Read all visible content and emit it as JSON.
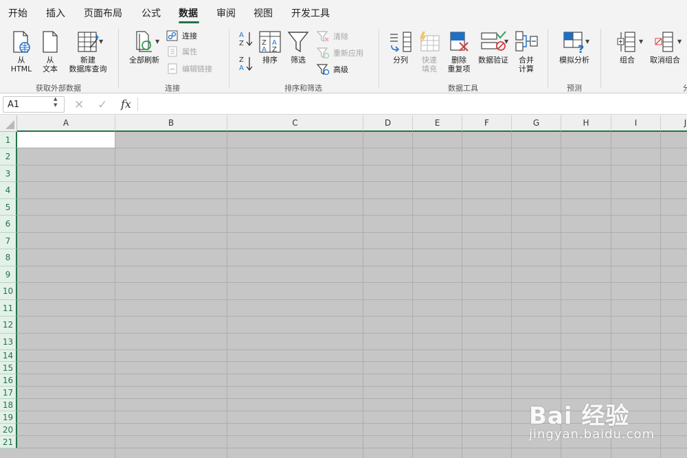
{
  "tabs": [
    {
      "label": "开始",
      "active": false
    },
    {
      "label": "插入",
      "active": false
    },
    {
      "label": "页面布局",
      "active": false
    },
    {
      "label": "公式",
      "active": false
    },
    {
      "label": "数据",
      "active": true
    },
    {
      "label": "审阅",
      "active": false
    },
    {
      "label": "视图",
      "active": false
    },
    {
      "label": "开发工具",
      "active": false
    }
  ],
  "ribbon": {
    "get_external": {
      "group_label": "获取外部数据",
      "from_html": "从\nHTML",
      "from_text": "从\n文本",
      "new_db_query": "新建\n数据库查询"
    },
    "connections": {
      "group_label": "连接",
      "refresh_all": "全部刷新",
      "connections": "连接",
      "properties": "属性",
      "edit_links": "编辑链接"
    },
    "sort_filter": {
      "group_label": "排序和筛选",
      "sort": "排序",
      "filter": "筛选",
      "clear": "清除",
      "reapply": "重新应用",
      "advanced": "高级"
    },
    "data_tools": {
      "group_label": "数据工具",
      "text_to_columns": "分列",
      "flash_fill": "快速\n填充",
      "remove_duplicates": "删除\n重复项",
      "data_validation": "数据验证",
      "consolidate": "合并\n计算"
    },
    "forecast": {
      "group_label": "预测",
      "what_if": "模拟分析"
    },
    "outline": {
      "group_label": "分",
      "group": "组合",
      "ungroup": "取消组合"
    }
  },
  "formula_bar": {
    "name_box": "A1",
    "fx": "fx",
    "formula": ""
  },
  "grid": {
    "columns": [
      "A",
      "B",
      "C",
      "D",
      "E",
      "F",
      "G",
      "H",
      "I",
      "J"
    ],
    "rows": [
      "1",
      "2",
      "3",
      "4",
      "5",
      "6",
      "7",
      "8",
      "9",
      "10",
      "11",
      "12",
      "13",
      "14",
      "15",
      "16",
      "17",
      "18",
      "19",
      "20",
      "21"
    ]
  },
  "watermark": {
    "brand": "Bai 经验",
    "url": "jingyan.baidu.com"
  },
  "colors": {
    "accent": "#217346",
    "cell_fill": "#c6c6c6",
    "ribbon_bg": "#f3f3f3"
  }
}
